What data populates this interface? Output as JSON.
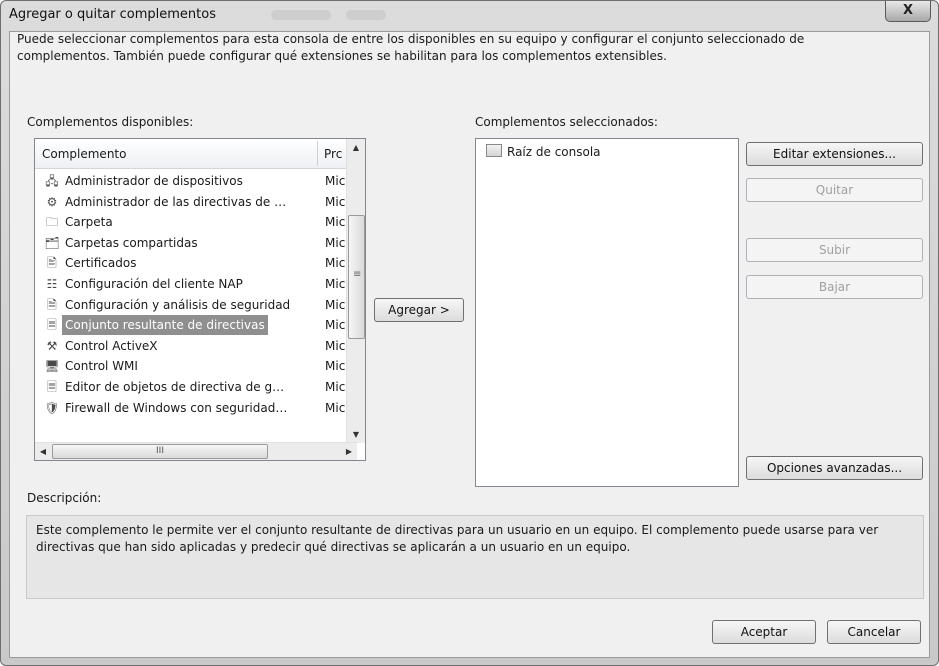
{
  "window": {
    "title": "Agregar o quitar complementos",
    "close_label": "X"
  },
  "intro": "Puede seleccionar complementos para esta consola de entre los disponibles en su equipo y configurar el conjunto seleccionado de complementos. También puede configurar qué extensiones se habilitan para los complementos extensibles.",
  "available": {
    "label": "Complementos disponibles:",
    "col_name": "Complemento",
    "col_provider": "Prc",
    "items": [
      {
        "icon": "device-manager-icon",
        "glyph": "🖧",
        "name": "Administrador de dispositivos",
        "provider": "Mic"
      },
      {
        "icon": "policy-manager-icon",
        "glyph": "⚙",
        "name": "Administrador de las directivas de …",
        "provider": "Mic"
      },
      {
        "icon": "folder-icon",
        "glyph": "🗀",
        "name": "Carpeta",
        "provider": "Mic"
      },
      {
        "icon": "shared-folders-icon",
        "glyph": "🗂",
        "name": "Carpetas compartidas",
        "provider": "Mic"
      },
      {
        "icon": "certificates-icon",
        "glyph": "🖹",
        "name": "Certificados",
        "provider": "Mic"
      },
      {
        "icon": "nap-client-icon",
        "glyph": "☷",
        "name": "Configuración del cliente NAP",
        "provider": "Mic"
      },
      {
        "icon": "security-analysis-icon",
        "glyph": "🗎",
        "name": "Configuración y análisis de seguridad",
        "provider": "Mic"
      },
      {
        "icon": "policy-document-icon",
        "glyph": "🗏",
        "name": "Conjunto resultante de directivas",
        "provider": "Mic",
        "selected": true
      },
      {
        "icon": "activex-control-icon",
        "glyph": "⚒",
        "name": "Control ActiveX",
        "provider": "Mic"
      },
      {
        "icon": "wmi-control-icon",
        "glyph": "🖥",
        "name": "Control WMI",
        "provider": "Mic"
      },
      {
        "icon": "policy-editor-icon",
        "glyph": "🗏",
        "name": "Editor de objetos de directiva de g…",
        "provider": "Mic"
      },
      {
        "icon": "firewall-icon",
        "glyph": "🛡",
        "name": "Firewall de Windows con seguridad…",
        "provider": "Mic"
      }
    ],
    "hscroll_thumb": "III"
  },
  "add_button": "Agregar >",
  "selected": {
    "label": "Complementos seleccionados:",
    "items": [
      {
        "icon": "console-root-icon",
        "name": "Raíz de consola"
      }
    ]
  },
  "side_buttons": {
    "edit_extensions": "Editar extensiones...",
    "remove": "Quitar",
    "move_up": "Subir",
    "move_down": "Bajar",
    "advanced": "Opciones avanzadas..."
  },
  "description": {
    "label": "Descripción:",
    "text": "Este complemento le permite ver el conjunto resultante de directivas para un usuario en un equipo. El complemento puede usarse para ver directivas que han sido aplicadas y predecir qué directivas se aplicarán a un usuario en un equipo."
  },
  "footer": {
    "ok": "Aceptar",
    "cancel": "Cancelar"
  }
}
